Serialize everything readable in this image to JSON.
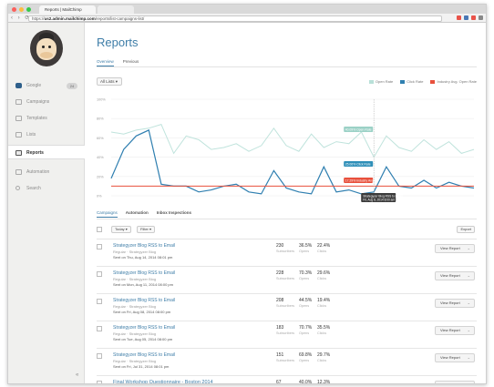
{
  "browser": {
    "tabs": [
      {
        "label": "Reports | MailChimp",
        "active": true
      },
      {
        "label": "",
        "active": false
      }
    ],
    "url_prefix": "https://",
    "url_host": "us2.admin.mailchimp.com",
    "url_path": "/reports/list-campaigns-list/"
  },
  "sidebar": {
    "items": [
      {
        "label": "Google",
        "badge": "24"
      },
      {
        "label": "Campaigns"
      },
      {
        "label": "Templates"
      },
      {
        "label": "Lists"
      },
      {
        "label": "Reports"
      },
      {
        "label": "Automation"
      },
      {
        "label": "Search"
      }
    ],
    "collapse": "«"
  },
  "header": {
    "title": "Reports",
    "tabs": [
      "Overview",
      "Previous"
    ]
  },
  "chart_controls": {
    "list_dropdown": "All Lists",
    "legend": [
      {
        "name": "Open Rate",
        "color": "#b9e0d8"
      },
      {
        "name": "Click Rate",
        "color": "#2f7fb0"
      },
      {
        "name": "Industry Avg. Open Rate",
        "color": "#e8503c"
      }
    ]
  },
  "chart_data": {
    "type": "line",
    "ylabel": "",
    "yticks": [
      "100%",
      "80%",
      "60%",
      "40%",
      "20%",
      "0%"
    ],
    "ylim": [
      0,
      100
    ],
    "x": [
      1,
      2,
      3,
      4,
      5,
      6,
      7,
      8,
      9,
      10,
      11,
      12,
      13,
      14,
      15,
      16,
      17,
      18,
      19,
      20,
      21,
      22,
      23,
      24,
      25,
      26,
      27,
      28,
      29,
      30
    ],
    "series": [
      {
        "name": "Open Rate",
        "color": "#bfe3dc",
        "values": [
          66,
          64,
          68,
          70,
          74,
          44,
          62,
          58,
          48,
          50,
          54,
          46,
          52,
          70,
          52,
          46,
          64,
          50,
          56,
          54,
          66,
          40,
          62,
          50,
          46,
          58,
          48,
          56,
          44,
          48
        ]
      },
      {
        "name": "Click Rate",
        "color": "#2f7fb0",
        "values": [
          18,
          48,
          62,
          68,
          12,
          10,
          10,
          4,
          6,
          10,
          12,
          4,
          2,
          26,
          8,
          4,
          2,
          30,
          4,
          6,
          2,
          4,
          30,
          10,
          8,
          16,
          8,
          14,
          10,
          8
        ]
      },
      {
        "name": "Industry Avg. Open Rate",
        "color": "#e8503c",
        "values": [
          10,
          10,
          10,
          10,
          10,
          10,
          10,
          10,
          10,
          10,
          10,
          10,
          10,
          10,
          10,
          10,
          10,
          10,
          10,
          10,
          10,
          10,
          10,
          10,
          10,
          10,
          10,
          10,
          10,
          10
        ]
      }
    ],
    "tooltips": [
      {
        "text": "40.09% Open Rate",
        "color": "#9bd1c6"
      },
      {
        "text": "25.06% Click Rate",
        "color": "#2f8fb8"
      },
      {
        "text": "17.29% Industry Avg",
        "color": "#e8503c"
      }
    ],
    "hover_label": [
      "Strategyzer Blog RSS to Email",
      "Fri, Aug 8, 2014 8:00 am"
    ],
    "grid": true
  },
  "campaigns": {
    "tabs": [
      "Campaigns",
      "Automation",
      "Inbox Inspections"
    ],
    "filters": {
      "sort": "Today",
      "filter": "Filter",
      "export": "Export"
    },
    "rows": [
      {
        "title": "Strategyzer Blog RSS to Email",
        "list": "Regular · Strategyzer Blog",
        "sent": "Sent on Thu, Aug 14, 2014 08:01 pm",
        "subscribers": "230",
        "opens": "36.5%",
        "clicks": "22.4%",
        "button": "View Report"
      },
      {
        "title": "Strategyzer Blog RSS to Email",
        "list": "Regular · Strategyzer Blog",
        "sent": "Sent on Mon, Aug 11, 2014 08:00 pm",
        "subscribers": "228",
        "opens": "70.3%",
        "clicks": "29.6%",
        "button": "View Report"
      },
      {
        "title": "Strategyzer Blog RSS to Email",
        "list": "Regular · Strategyzer Blog",
        "sent": "Sent on Fri, Aug 08, 2014 08:00 pm",
        "subscribers": "208",
        "opens": "44.5%",
        "clicks": "19.4%",
        "button": "View Report"
      },
      {
        "title": "Strategyzer Blog RSS to Email",
        "list": "Regular · Strategyzer Blog",
        "sent": "Sent on Tue, Aug 05, 2014 08:00 pm",
        "subscribers": "183",
        "opens": "70.7%",
        "clicks": "35.5%",
        "button": "View Report"
      },
      {
        "title": "Strategyzer Blog RSS to Email",
        "list": "Regular · Strategyzer Blog",
        "sent": "Sent on Fri, Jul 31, 2014 08:01 pm",
        "subscribers": "151",
        "opens": "69.8%",
        "clicks": "29.7%",
        "button": "View Report"
      },
      {
        "title": "Final Workshop Questionnaire - Boston 2014",
        "list": "",
        "sent": "",
        "subscribers": "67",
        "opens": "40.0%",
        "clicks": "12.3%",
        "button": "View Report"
      }
    ],
    "col_labels": [
      "Subscribers",
      "Opens",
      "Clicks"
    ]
  }
}
